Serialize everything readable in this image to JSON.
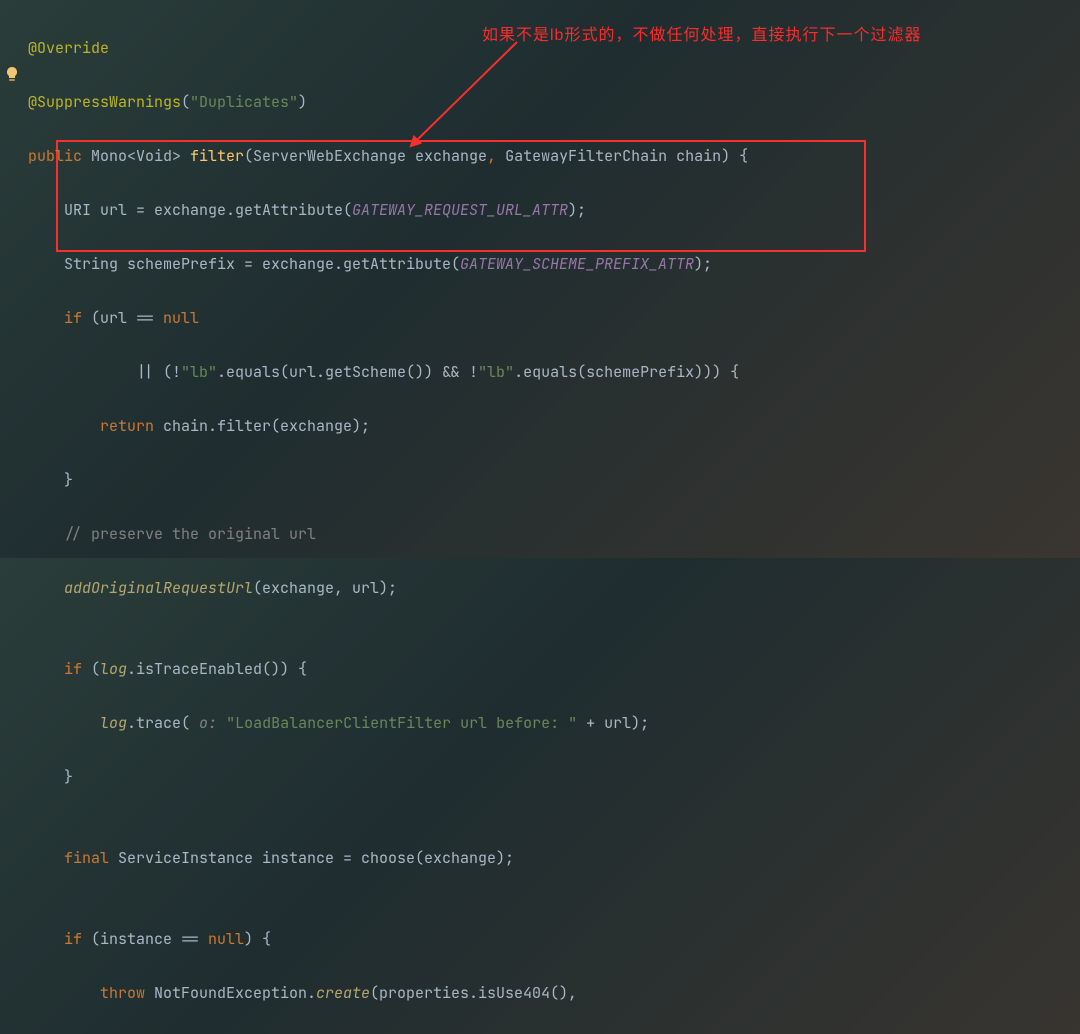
{
  "annotation": {
    "text": "如果不是lb形式的，不做任何处理，直接执行下一个过滤器"
  },
  "code": {
    "l1": {
      "anno": "@Override"
    },
    "l2": {
      "anno": "@SuppressWarnings",
      "p": "(",
      "str": "\"Duplicates\"",
      "p2": ")"
    },
    "l3": {
      "kw1": "public ",
      "t1": "Mono<Void> ",
      "m": "filter",
      "p1": "(ServerWebExchange exchange",
      "c": ", ",
      "p2": "GatewayFilterChain chain) {"
    },
    "l4": {
      "t": "    URI url = exchange.getAttribute(",
      "c": "GATEWAY_REQUEST_URL_ATTR",
      "e": ");"
    },
    "l5": {
      "t": "    String schemePrefix = exchange.getAttribute(",
      "c": "GATEWAY_SCHEME_PREFIX_ATTR",
      "e": ");"
    },
    "l6": {
      "kw": "    if ",
      "t": "(url == ",
      "nul": "null"
    },
    "l7": {
      "t": "            || (!",
      "s1": "\"lb\"",
      "t2": ".equals(url.getScheme()) && !",
      "s2": "\"lb\"",
      "t3": ".equals(schemePrefix))) {"
    },
    "l8": {
      "kw": "        return ",
      "t": "chain.filter(exchange);"
    },
    "l9": {
      "t": "    }"
    },
    "l10": {
      "c": "    // preserve the original url"
    },
    "l11": {
      "m": "    addOriginalRequestUrl",
      "t": "(exchange, url);"
    },
    "l12": {
      "t": ""
    },
    "l13": {
      "kw": "    if ",
      "t": "(",
      "s": "log",
      "t2": ".isTraceEnabled()) {"
    },
    "l14": {
      "t": "        ",
      "s": "log",
      "t2": ".trace(",
      "hint": " o: ",
      "str": "\"LoadBalancerClientFilter url before: \"",
      "t3": " + url);"
    },
    "l15": {
      "t": "    }"
    },
    "l16": {
      "t": ""
    },
    "l17": {
      "kw": "    final ",
      "t": "ServiceInstance instance = choose(exchange);"
    },
    "l18": {
      "t": ""
    },
    "l19": {
      "kw": "    if ",
      "t": "(instance == ",
      "nul": "null",
      "t2": ") {"
    },
    "l20": {
      "kw": "        throw ",
      "t": "NotFoundException.",
      "m": "create",
      "t2": "(properties.isUse404(),"
    }
  }
}
